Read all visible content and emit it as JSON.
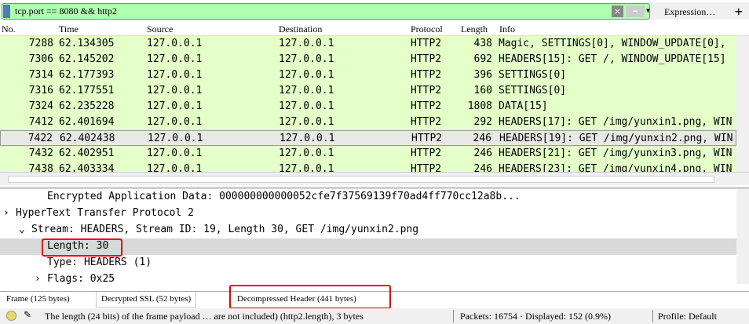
{
  "filter": {
    "value": "tcp.port == 8080 && http2",
    "clear": "✕",
    "apply": "➡",
    "expression_label": "Expression…",
    "add": "+"
  },
  "columns": [
    "No.",
    "Time",
    "Source",
    "Destination",
    "Protocol",
    "Length",
    "Info"
  ],
  "packets": [
    {
      "no": "7288",
      "time": "62.134305",
      "src": "127.0.0.1",
      "dst": "127.0.0.1",
      "proto": "HTTP2",
      "len": "438",
      "info": "Magic, SETTINGS[0], WINDOW_UPDATE[0],"
    },
    {
      "no": "7306",
      "time": "62.145202",
      "src": "127.0.0.1",
      "dst": "127.0.0.1",
      "proto": "HTTP2",
      "len": "692",
      "info": "HEADERS[15]: GET /, WINDOW_UPDATE[15]"
    },
    {
      "no": "7314",
      "time": "62.177393",
      "src": "127.0.0.1",
      "dst": "127.0.0.1",
      "proto": "HTTP2",
      "len": "396",
      "info": "SETTINGS[0]"
    },
    {
      "no": "7316",
      "time": "62.177551",
      "src": "127.0.0.1",
      "dst": "127.0.0.1",
      "proto": "HTTP2",
      "len": "160",
      "info": "SETTINGS[0]"
    },
    {
      "no": "7324",
      "time": "62.235228",
      "src": "127.0.0.1",
      "dst": "127.0.0.1",
      "proto": "HTTP2",
      "len": "1808",
      "info": "DATA[15]"
    },
    {
      "no": "7412",
      "time": "62.401694",
      "src": "127.0.0.1",
      "dst": "127.0.0.1",
      "proto": "HTTP2",
      "len": "292",
      "info": "HEADERS[17]: GET /img/yunxin1.png, WIN"
    },
    {
      "no": "7422",
      "time": "62.402438",
      "src": "127.0.0.1",
      "dst": "127.0.0.1",
      "proto": "HTTP2",
      "len": "246",
      "info": "HEADERS[19]: GET /img/yunxin2.png, WIN"
    },
    {
      "no": "7432",
      "time": "62.402951",
      "src": "127.0.0.1",
      "dst": "127.0.0.1",
      "proto": "HTTP2",
      "len": "246",
      "info": "HEADERS[21]: GET /img/yunxin3.png, WIN"
    },
    {
      "no": "7438",
      "time": "62.403334",
      "src": "127.0.0.1",
      "dst": "127.0.0.1",
      "proto": "HTTP2",
      "len": "246",
      "info": "HEADERS[23]: GET /img/yunxin4.png, WIN"
    }
  ],
  "details": [
    {
      "text": "Encrypted Application Data: 000000000000052cfe7f37569139f70ad4ff770cc12a8b...",
      "arrow": ""
    },
    {
      "text": "HyperText Transfer Protocol 2",
      "arrow": "›"
    },
    {
      "text": "Stream: HEADERS, Stream ID: 19, Length 30, GET /img/yunxin2.png",
      "arrow": "⌄"
    },
    {
      "text": "Length: 30",
      "arrow": ""
    },
    {
      "text": "Type: HEADERS (1)",
      "arrow": ""
    },
    {
      "text": "Flags: 0x25",
      "arrow": "›"
    }
  ],
  "tabs": [
    "Frame (125 bytes)",
    "Decrypted SSL (52 bytes)",
    "Decompressed Header (441 bytes)"
  ],
  "status": {
    "message": "The length (24 bits) of the frame payload … are not included) (http2.length), 3 bytes",
    "packets": "Packets: 16754 · Displayed: 152 (0.9%)",
    "profile": "Profile: Default"
  }
}
